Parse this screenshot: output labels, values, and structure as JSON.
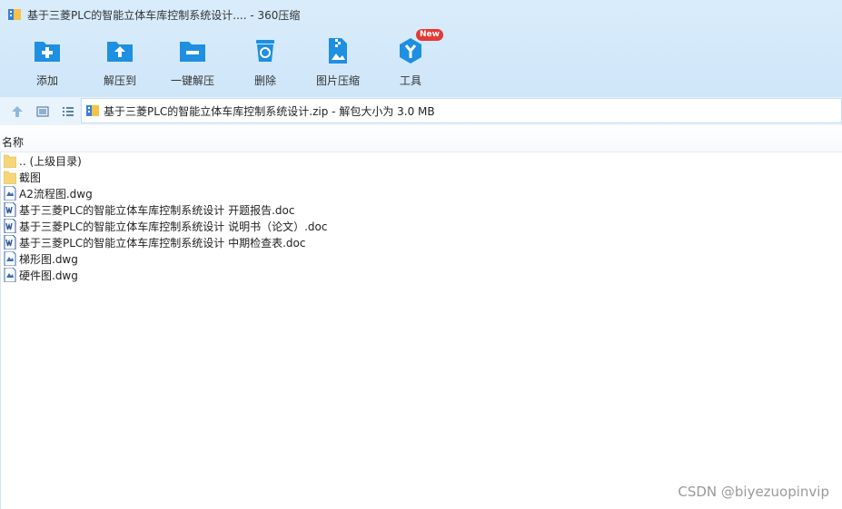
{
  "window": {
    "title": "基于三菱PLC的智能立体车库控制系统设计.... - 360压缩"
  },
  "toolbar": {
    "items": [
      {
        "label": "添加",
        "icon": "folder-add-icon"
      },
      {
        "label": "解压到",
        "icon": "extract-to-icon"
      },
      {
        "label": "一键解压",
        "icon": "one-click-extract-icon"
      },
      {
        "label": "删除",
        "icon": "recycle-bin-icon"
      },
      {
        "label": "图片压缩",
        "icon": "image-compress-icon"
      },
      {
        "label": "工具",
        "icon": "tools-icon",
        "badge": "New"
      }
    ]
  },
  "address": {
    "text": "基于三菱PLC的智能立体车库控制系统设计.zip - 解包大小为 3.0 MB"
  },
  "list": {
    "header": "名称",
    "files": [
      {
        "name": ".. (上级目录)",
        "type": "folder"
      },
      {
        "name": "截图",
        "type": "folder"
      },
      {
        "name": "A2流程图.dwg",
        "type": "dwg"
      },
      {
        "name": "基于三菱PLC的智能立体车库控制系统设计 开题报告.doc",
        "type": "doc"
      },
      {
        "name": "基于三菱PLC的智能立体车库控制系统设计 说明书（论文）.doc",
        "type": "doc"
      },
      {
        "name": "基于三菱PLC的智能立体车库控制系统设计 中期检查表.doc",
        "type": "doc"
      },
      {
        "name": "梯形图.dwg",
        "type": "dwg"
      },
      {
        "name": "硬件图.dwg",
        "type": "dwg"
      }
    ]
  },
  "watermark": "CSDN @biyezuopinvip",
  "colors": {
    "accent": "#1e8fe1",
    "toolbar_bg": "#d3e8fa",
    "folder": "#f5d67a"
  }
}
